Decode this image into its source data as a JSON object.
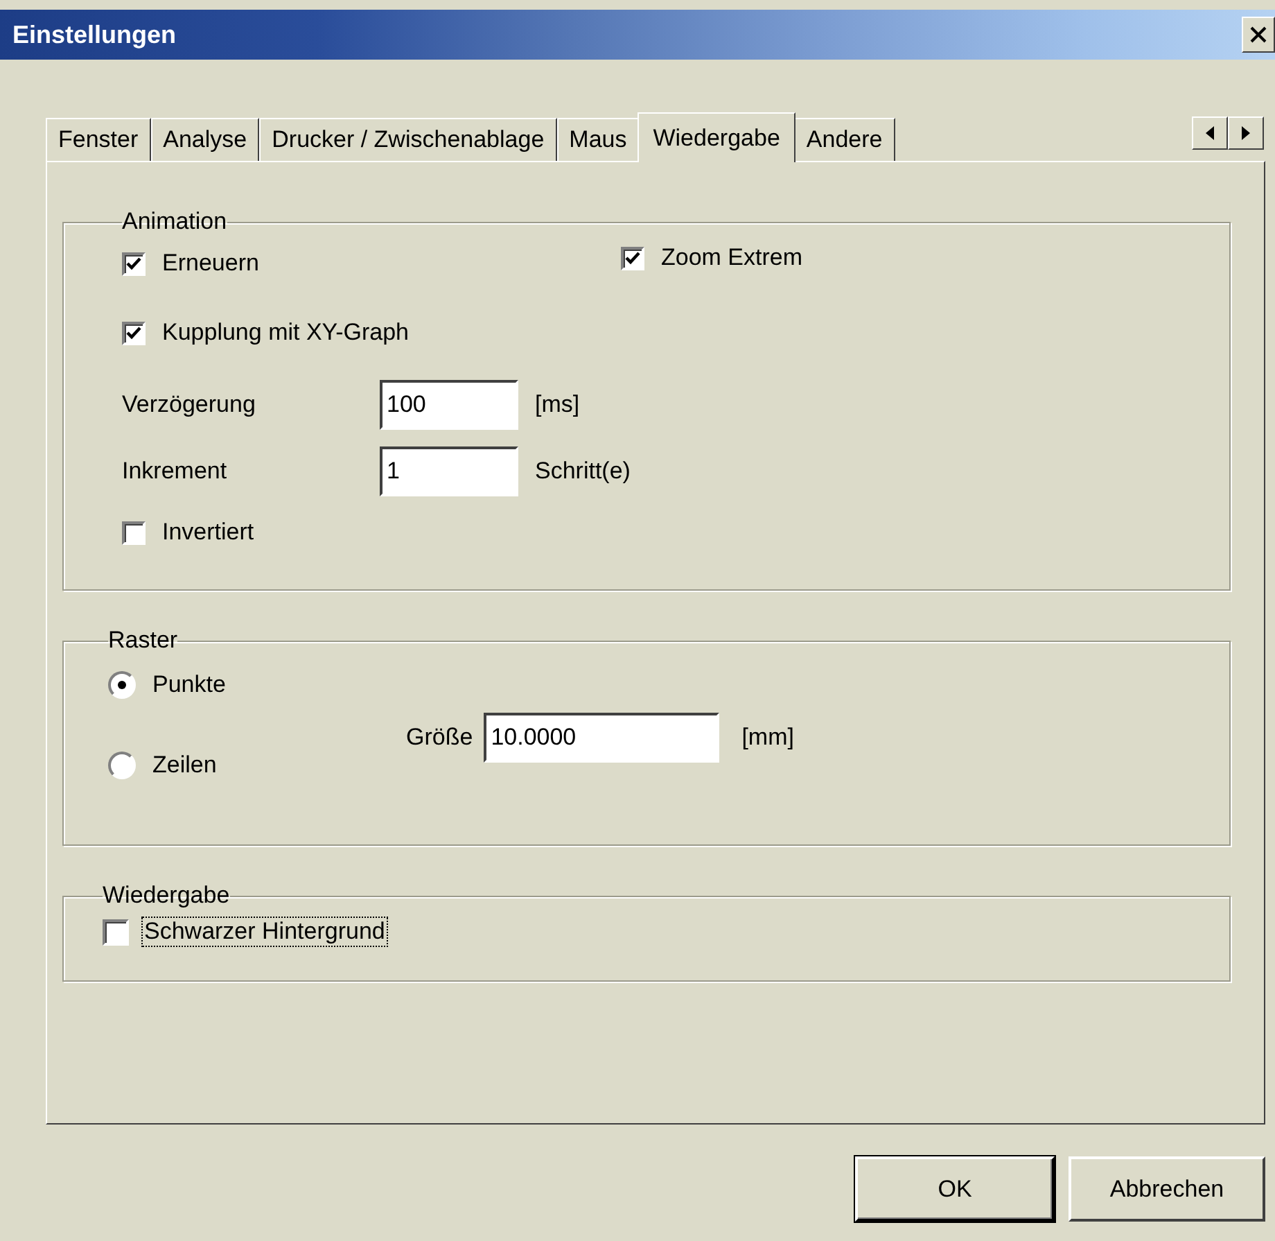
{
  "window": {
    "title": "Einstellungen"
  },
  "tabs": [
    {
      "label": "Fenster",
      "selected": false
    },
    {
      "label": "Analyse",
      "selected": false
    },
    {
      "label": "Drucker / Zwischenablage",
      "selected": false
    },
    {
      "label": "Maus",
      "selected": false
    },
    {
      "label": "Wiedergabe",
      "selected": true
    },
    {
      "label": "Andere",
      "selected": false
    }
  ],
  "animation": {
    "title": "Animation",
    "checkboxes": [
      {
        "label": "Erneuern",
        "checked": true
      },
      {
        "label": "Zoom Extrem",
        "checked": true
      },
      {
        "label": "Kupplung mit XY-Graph",
        "checked": true
      }
    ],
    "fields": [
      {
        "label": "Verzögerung",
        "value": "100",
        "unit": "[ms]"
      },
      {
        "label": "Inkrement",
        "value": "1",
        "unit": "Schritt(e)"
      }
    ],
    "inverted": {
      "label": "Invertiert",
      "checked": false
    }
  },
  "raster": {
    "title": "Raster",
    "options": [
      {
        "label": "Punkte",
        "selected": true
      },
      {
        "label": "Zeilen",
        "selected": false
      }
    ],
    "size": {
      "label": "Größe",
      "value": "10.0000",
      "unit": "[mm]"
    }
  },
  "playback": {
    "title": "Wiedergabe",
    "checkbox": {
      "label": "Schwarzer Hintergrund",
      "checked": false,
      "focused": true
    }
  },
  "buttons": [
    {
      "label": "OK",
      "default": true
    },
    {
      "label": "Abbrechen",
      "default": false
    }
  ]
}
